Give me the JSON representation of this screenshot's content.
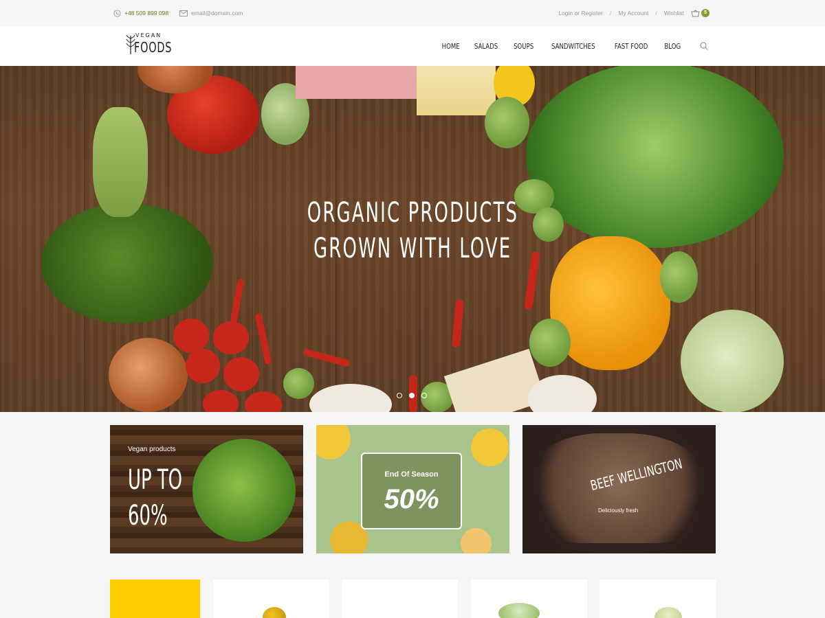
{
  "topbar": {
    "phone": "+48 509 899 098",
    "email": "email@domain.com",
    "login": "Login or Register",
    "my_account": "My Account",
    "wishlist": "Wishlist",
    "separator": "/",
    "cart_count": "5"
  },
  "logo": {
    "top": "VEGAN",
    "main": "FOODS"
  },
  "nav": {
    "items": [
      "HOME",
      "SALADS",
      "SOUPS",
      "SANDWITCHES",
      "FAST FOOD",
      "BLOG"
    ]
  },
  "hero": {
    "line1": "ORGANIC PRODUCTS",
    "line2": "GROWN WITH LOVE",
    "slides": 3,
    "active_slide": 2
  },
  "promos": {
    "p1_small": "Vegan products",
    "p1_big_line1": "UP TO",
    "p1_big_line2": "60%",
    "p2_small": "End Of Season",
    "p2_big": "50%",
    "p3_title": "BEEF WELLINGTON",
    "p3_sub": "Deliciously fresh"
  },
  "colors": {
    "accent": "#8a9a2b",
    "yellow": "#ffcc00"
  }
}
